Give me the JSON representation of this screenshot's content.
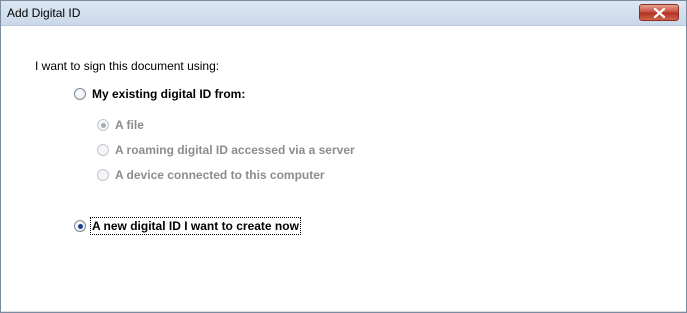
{
  "window": {
    "title": "Add Digital ID"
  },
  "dialog": {
    "prompt": "I want to sign this document using:",
    "options": {
      "existing": {
        "label": "My existing digital ID from:",
        "selected": false,
        "enabled": true
      },
      "file": {
        "label": "A file",
        "selected": true,
        "enabled": false
      },
      "roaming": {
        "label": "A roaming digital ID accessed via a server",
        "selected": false,
        "enabled": false
      },
      "device": {
        "label": "A device connected to this computer",
        "selected": false,
        "enabled": false
      },
      "new_id": {
        "label": "A new digital ID I want to create now",
        "selected": true,
        "enabled": true
      }
    }
  },
  "colors": {
    "accent": "#1f3f86",
    "disabled_text": "#8c8c8c",
    "close_button": "#c5493a"
  }
}
